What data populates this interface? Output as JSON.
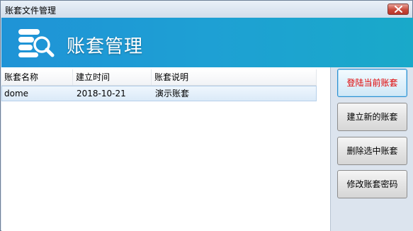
{
  "window": {
    "title": "账套文件管理",
    "close_label": "close"
  },
  "banner": {
    "title": "账套管理",
    "icon": "database-search-icon"
  },
  "list": {
    "columns": [
      "账套名称",
      "建立时间",
      "账套说明"
    ],
    "rows": [
      [
        "dome",
        "2018-10-21",
        "演示账套"
      ]
    ]
  },
  "actions": {
    "login_current": "登陆当前账套",
    "create_new": "建立新的账套",
    "delete_selected": "删除选中账套",
    "change_password": "修改账套密码"
  },
  "colors": {
    "banner": "#1e9fd4",
    "primary_text": "#e00000",
    "selection": "#dbeaf8"
  }
}
